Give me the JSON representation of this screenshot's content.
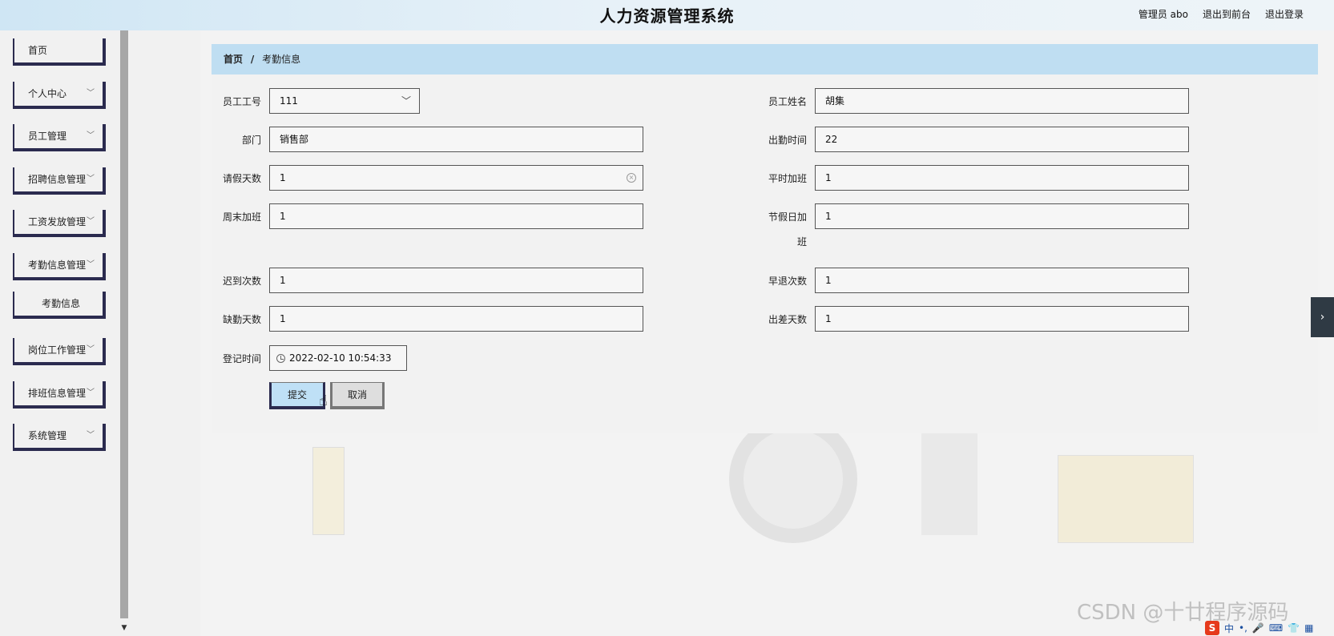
{
  "header": {
    "title": "人力资源管理系统",
    "user_label": "管理员 abo",
    "front_link": "退出到前台",
    "logout_link": "退出登录"
  },
  "sidebar": {
    "items": [
      {
        "label": "首页"
      },
      {
        "label": "个人中心"
      },
      {
        "label": "员工管理"
      },
      {
        "label": "招聘信息管理"
      },
      {
        "label": "工资发放管理"
      },
      {
        "label": "考勤信息管理"
      },
      {
        "label": "考勤信息"
      },
      {
        "label": "岗位工作管理"
      },
      {
        "label": "排班信息管理"
      },
      {
        "label": "系统管理"
      }
    ]
  },
  "breadcrumb": {
    "home": "首页",
    "separator": "/",
    "current": "考勤信息"
  },
  "form": {
    "emp_no_label": "员工工号",
    "emp_no_value": "111",
    "emp_name_label": "员工姓名",
    "emp_name_value": "胡集",
    "dept_label": "部门",
    "dept_value": "销售部",
    "attend_label": "出勤时间",
    "attend_value": "22",
    "leave_label": "请假天数",
    "leave_value": "1",
    "weekday_ot_label": "平时加班",
    "weekday_ot_value": "1",
    "weekend_ot_label": "周末加班",
    "weekend_ot_value": "1",
    "holiday_ot_label_1": "节假日加",
    "holiday_ot_label_2": "班",
    "holiday_ot_value": "1",
    "late_label": "迟到次数",
    "late_value": "1",
    "early_label": "早退次数",
    "early_value": "1",
    "absent_label": "缺勤天数",
    "absent_value": "1",
    "trip_label": "出差天数",
    "trip_value": "1",
    "record_time_label": "登记时间",
    "record_time_value": "2022-02-10 10:54:33",
    "submit_label": "提交",
    "cancel_label": "取消"
  },
  "watermark": "CSDN @十廿程序源码",
  "tray": {
    "ime_label": "中"
  },
  "colors": {
    "accent_blue": "#bfdef2",
    "menu_border": "#2b2b4f"
  }
}
